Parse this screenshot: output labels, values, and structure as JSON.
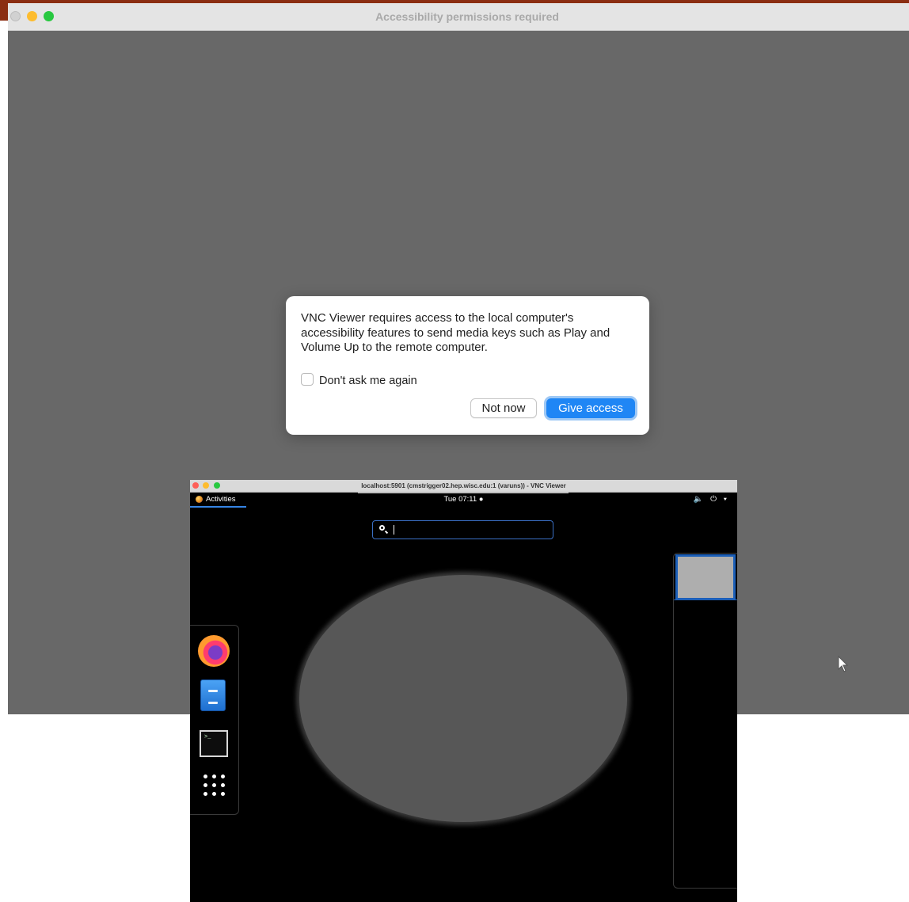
{
  "mac_window": {
    "title": "Accessibility permissions required"
  },
  "dialog": {
    "message": "VNC Viewer requires access to the local computer's accessibility features to send media keys such as Play and Volume Up to the remote computer.",
    "checkbox_label": "Don't ask me again",
    "checkbox_checked": false,
    "not_now_label": "Not now",
    "give_access_label": "Give access",
    "accent_color": "#1f86f5"
  },
  "vnc": {
    "title": "localhost:5901 (cmstrigger02.hep.wisc.edu:1 (varuns)) - VNC Viewer",
    "activities_label": "Activities",
    "clock": "Tue 07:11 ●",
    "system_icons": "🔈 ⏻ ▾",
    "search_value": "",
    "dash_items": [
      "firefox-icon",
      "files-icon",
      "terminal-icon",
      "show-apps-icon"
    ],
    "terminal_prompt": ">_"
  }
}
